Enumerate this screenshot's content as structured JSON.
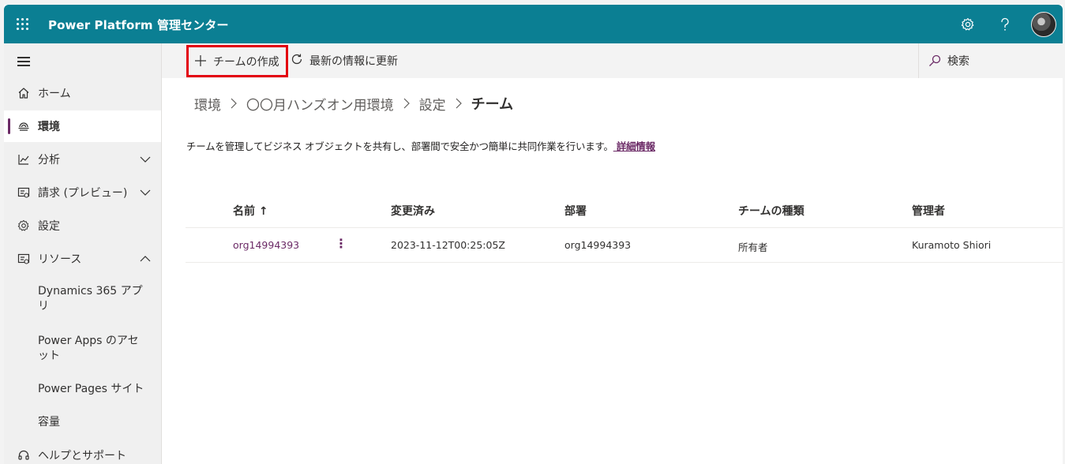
{
  "header": {
    "title": "Power Platform 管理センター",
    "settings_icon": "gear-icon",
    "help_icon": "question-icon"
  },
  "sidebar": {
    "items": [
      {
        "label": "ホーム",
        "icon": "home-icon"
      },
      {
        "label": "環境",
        "icon": "environment-icon"
      },
      {
        "label": "分析",
        "icon": "analytics-icon"
      },
      {
        "label": "請求 (プレビュー)",
        "icon": "billing-icon"
      },
      {
        "label": "設定",
        "icon": "gear-icon"
      },
      {
        "label": "リソース",
        "icon": "resources-icon"
      }
    ],
    "sub_items": [
      {
        "label": "Dynamics 365 アプリ"
      },
      {
        "label": "Power Apps のアセット"
      },
      {
        "label": "Power Pages サイト"
      },
      {
        "label": "容量"
      }
    ],
    "bottom_item": {
      "label": "ヘルプとサポート",
      "icon": "headset-icon"
    }
  },
  "commandbar": {
    "create_label": "チームの作成",
    "refresh_label": "最新の情報に更新",
    "search_label": "検索"
  },
  "breadcrumb": {
    "items": [
      "環境",
      "〇〇月ハンズオン用環境",
      "設定"
    ],
    "current": "チーム"
  },
  "description": {
    "text": "チームを管理してビジネス オブジェクトを共有し、部署間で安全かつ簡単に共同作業を行います。",
    "link": " 詳細情報"
  },
  "table": {
    "columns": [
      "名前 ↑",
      "変更済み",
      "部署",
      "チームの種類",
      "管理者"
    ],
    "rows": [
      {
        "name": "org14994393",
        "modified": "2023-11-12T00:25:05Z",
        "business_unit": "org14994393",
        "team_type": "所有者",
        "administrator": "Kuramoto Shiori"
      }
    ]
  },
  "colors": {
    "header_bg": "#0b7f93",
    "accent": "#6b2a66",
    "highlight": "#e3000f"
  }
}
